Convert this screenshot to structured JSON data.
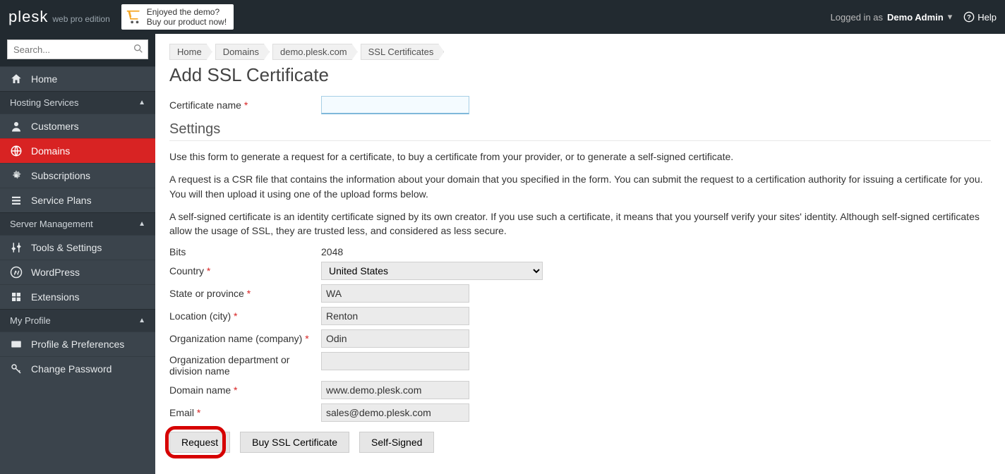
{
  "header": {
    "logo_main": "plesk",
    "logo_sub": "web pro edition",
    "promo_line1": "Enjoyed the demo?",
    "promo_line2": "Buy our product now!",
    "logged_in_prefix": "Logged in as",
    "username": "Demo Admin",
    "help": "Help"
  },
  "sidebar": {
    "search_placeholder": "Search...",
    "home": "Home",
    "group_hosting": "Hosting Services",
    "customers": "Customers",
    "domains": "Domains",
    "subscriptions": "Subscriptions",
    "service_plans": "Service Plans",
    "group_server": "Server Management",
    "tools": "Tools & Settings",
    "wordpress": "WordPress",
    "extensions": "Extensions",
    "group_profile": "My Profile",
    "profile_prefs": "Profile & Preferences",
    "change_password": "Change Password"
  },
  "breadcrumbs": [
    "Home",
    "Domains",
    "demo.plesk.com",
    "SSL Certificates"
  ],
  "page": {
    "title": "Add SSL Certificate",
    "cert_name_label": "Certificate name",
    "cert_name_value": "",
    "settings_heading": "Settings",
    "para1": "Use this form to generate a request for a certificate, to buy a certificate from your provider, or to generate a self-signed certificate.",
    "para2": "A request is a CSR file that contains the information about your domain that you specified in the form. You can submit the request to a certification authority for issuing a certificate for you. You will then upload it using one of the upload forms below.",
    "para3": "A self-signed certificate is an identity certificate signed by its own creator. If you use such a certificate, it means that you yourself verify your sites' identity. Although self-signed certificates allow the usage of SSL, they are trusted less, and considered as less secure.",
    "bits_label": "Bits",
    "bits_value": "2048",
    "country_label": "Country",
    "country_value": "United States",
    "state_label": "State or province",
    "state_value": "WA",
    "city_label": "Location (city)",
    "city_value": "Renton",
    "org_label": "Organization name (company)",
    "org_value": "Odin",
    "dept_label": "Organization department or division name",
    "dept_value": "",
    "domain_label": "Domain name",
    "domain_value": "www.demo.plesk.com",
    "email_label": "Email",
    "email_value": "sales@demo.plesk.com",
    "btn_request": "Request",
    "btn_buy": "Buy SSL Certificate",
    "btn_self": "Self-Signed"
  }
}
